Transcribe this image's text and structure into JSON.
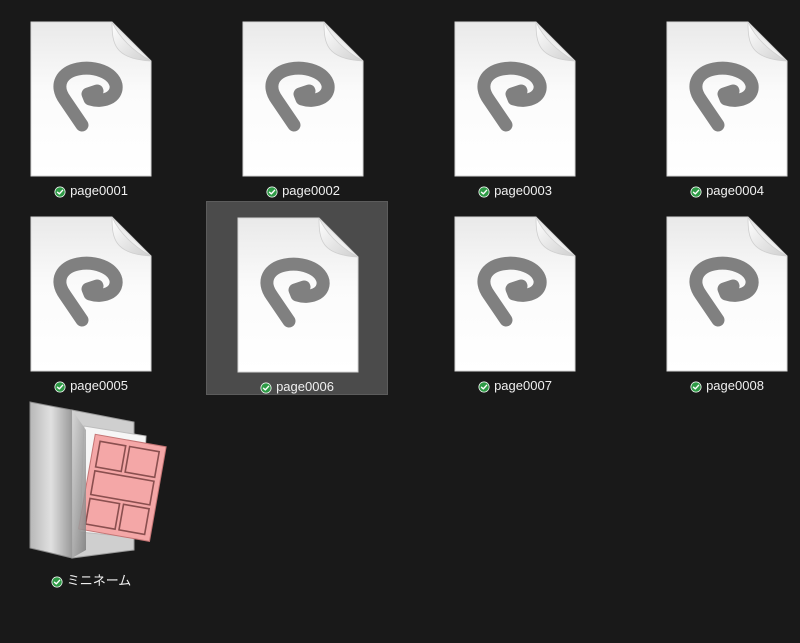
{
  "items": [
    {
      "name": "page0001",
      "type": "clip-file",
      "status_icon": "synced-check-icon",
      "selected": false
    },
    {
      "name": "page0002",
      "type": "clip-file",
      "status_icon": "synced-check-icon",
      "selected": false
    },
    {
      "name": "page0003",
      "type": "clip-file",
      "status_icon": "synced-check-icon",
      "selected": false
    },
    {
      "name": "page0004",
      "type": "clip-file",
      "status_icon": "synced-check-icon",
      "selected": false
    },
    {
      "name": "page0005",
      "type": "clip-file",
      "status_icon": "synced-check-icon",
      "selected": false
    },
    {
      "name": "page0006",
      "type": "clip-file",
      "status_icon": "synced-check-icon",
      "selected": true
    },
    {
      "name": "page0007",
      "type": "clip-file",
      "status_icon": "synced-check-icon",
      "selected": false
    },
    {
      "name": "page0008",
      "type": "clip-file",
      "status_icon": "synced-check-icon",
      "selected": false
    },
    {
      "name": "ミニネーム",
      "type": "comic-folder",
      "status_icon": "synced-check-icon",
      "selected": false
    }
  ],
  "colors": {
    "background": "#191919",
    "selection": "#4b4b4b",
    "label_text": "#f0f0f0",
    "status_check": "#2e9a46",
    "logo_gray": "#808080"
  }
}
